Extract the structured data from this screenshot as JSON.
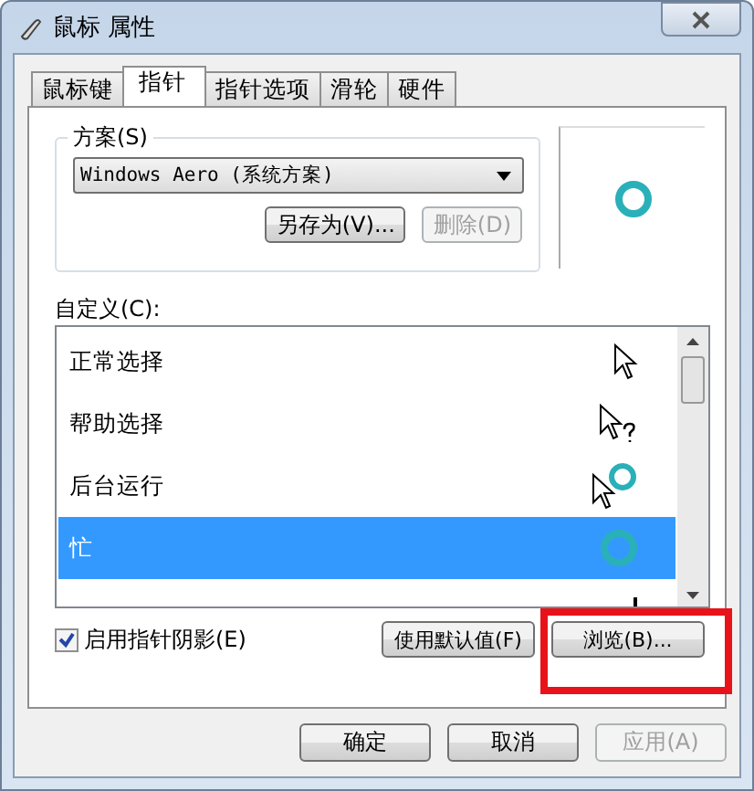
{
  "window": {
    "title": "鼠标 属性"
  },
  "tabs": [
    {
      "label": "鼠标键",
      "selected": false
    },
    {
      "label": "指针",
      "selected": true
    },
    {
      "label": "指针选项",
      "selected": false
    },
    {
      "label": "滑轮",
      "selected": false
    },
    {
      "label": "硬件",
      "selected": false
    }
  ],
  "scheme": {
    "label": "方案(S)",
    "value": "Windows Aero (系统方案)",
    "buttons": [
      {
        "label": "另存为(V)...",
        "disabled": false
      },
      {
        "label": "删除(D)",
        "disabled": true
      }
    ]
  },
  "customize": {
    "label": "自定义(C):",
    "rows": [
      {
        "label": "正常选择",
        "kind": "arrow",
        "selected": false
      },
      {
        "label": "帮助选择",
        "kind": "help",
        "selected": false
      },
      {
        "label": "后台运行",
        "kind": "working",
        "selected": false
      },
      {
        "label": "忙",
        "kind": "busy",
        "selected": true
      },
      {
        "kind": "precision",
        "selected": false
      }
    ]
  },
  "shadow": {
    "label": "启用指针阴影(E)",
    "checked": true
  },
  "list_buttons": [
    {
      "label": "使用默认值(F)",
      "highlighted": false
    },
    {
      "label": "浏览(B)...",
      "highlighted": true
    }
  ],
  "dialog_buttons": [
    {
      "label": "确定",
      "disabled": false
    },
    {
      "label": "取消",
      "disabled": false
    },
    {
      "label": "应用(A)",
      "disabled": true
    }
  ]
}
